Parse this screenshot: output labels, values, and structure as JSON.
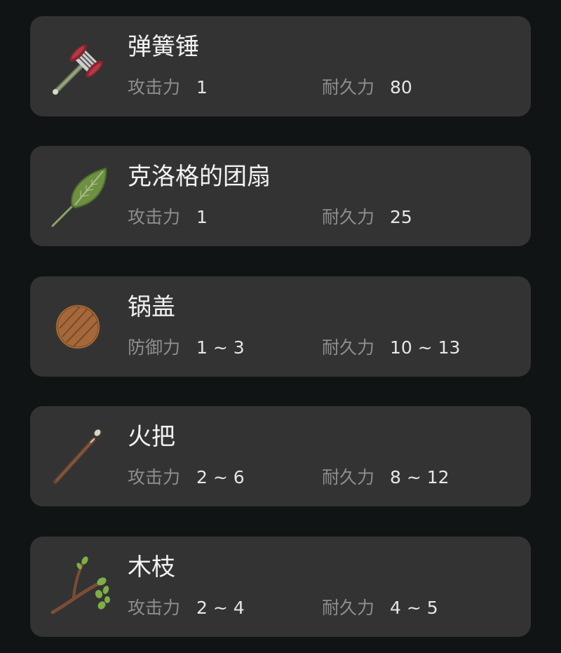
{
  "items": [
    {
      "name": "弹簧锤",
      "icon": "spring-hammer-icon",
      "stat1": {
        "label": "攻击力",
        "value": "1"
      },
      "stat2": {
        "label": "耐久力",
        "value": "80"
      }
    },
    {
      "name": "克洛格的团扇",
      "icon": "korok-leaf-icon",
      "stat1": {
        "label": "攻击力",
        "value": "1"
      },
      "stat2": {
        "label": "耐久力",
        "value": "25"
      }
    },
    {
      "name": "锅盖",
      "icon": "pot-lid-icon",
      "stat1": {
        "label": "防御力",
        "value": "1 ~ 3"
      },
      "stat2": {
        "label": "耐久力",
        "value": "10 ~ 13"
      }
    },
    {
      "name": "火把",
      "icon": "torch-icon",
      "stat1": {
        "label": "攻击力",
        "value": "2 ~ 6"
      },
      "stat2": {
        "label": "耐久力",
        "value": "8 ~ 12"
      }
    },
    {
      "name": "木枝",
      "icon": "tree-branch-icon",
      "stat1": {
        "label": "攻击力",
        "value": "2 ~ 4"
      },
      "stat2": {
        "label": "耐久力",
        "value": "4 ~ 5"
      }
    }
  ],
  "colors": {
    "background": "#101415",
    "card": "#333333",
    "title": "#f2f2f2",
    "label": "#8e8e8e",
    "value": "#e6e6e6"
  }
}
